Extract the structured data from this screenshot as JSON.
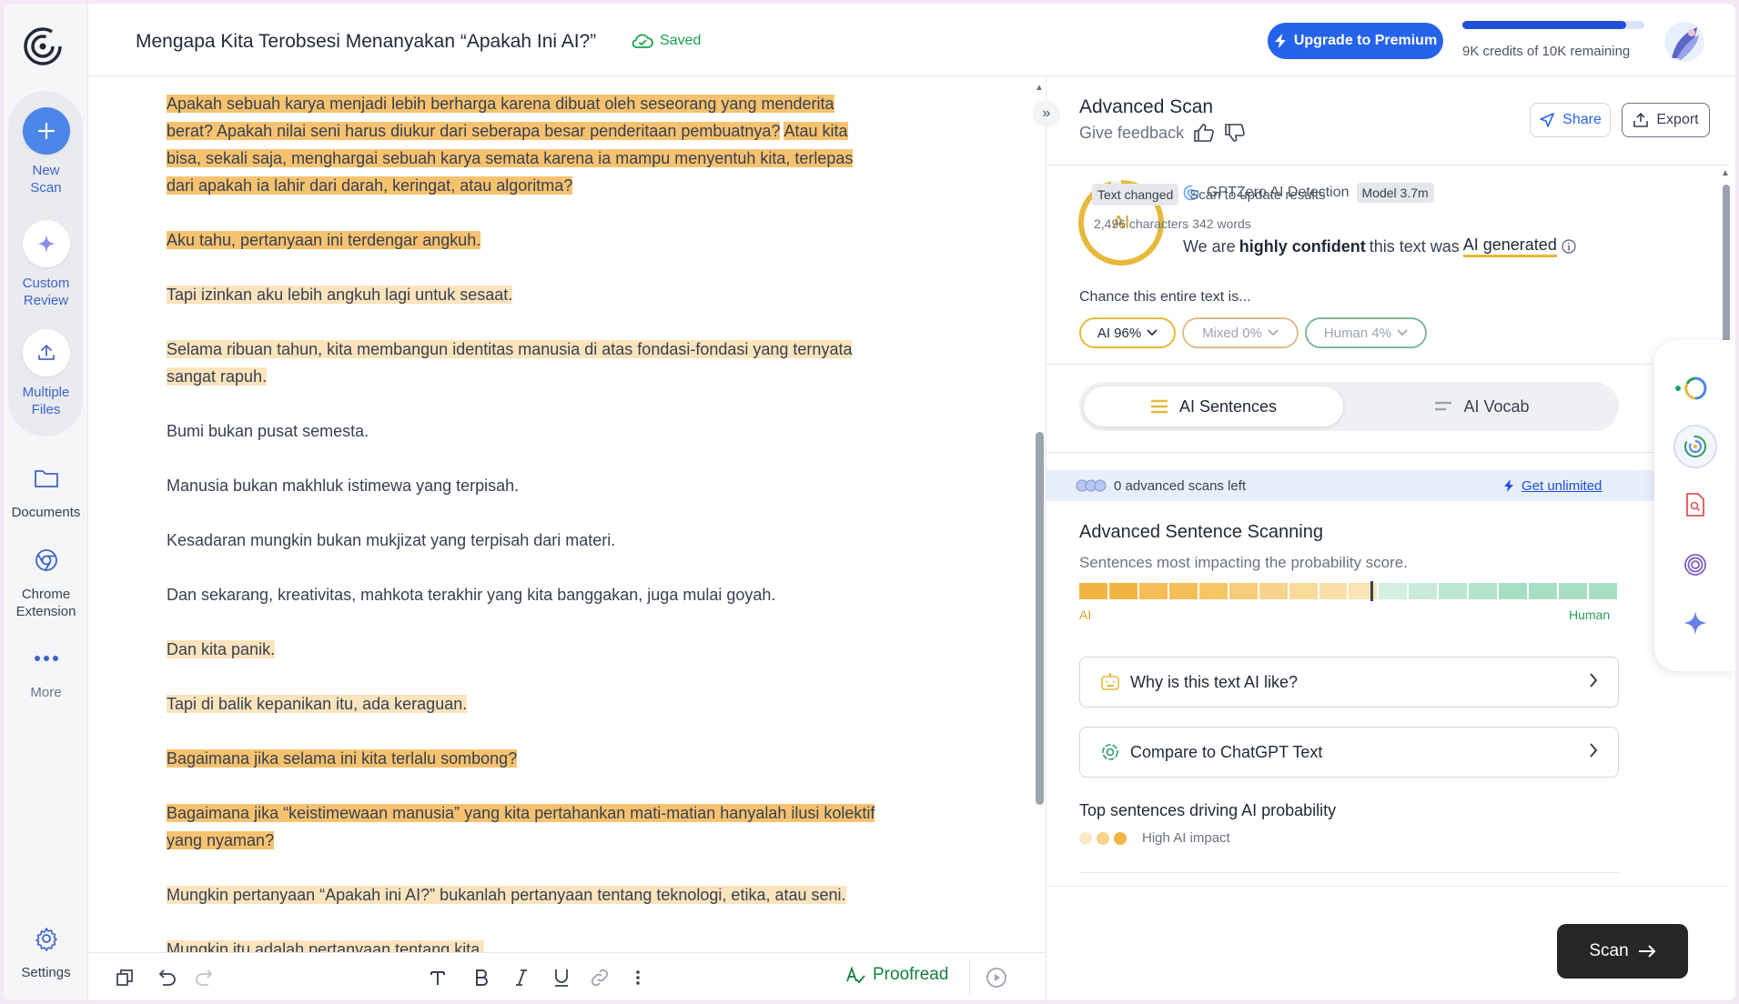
{
  "nav": {
    "new_scan": "New\nScan",
    "custom_review": "Custom\nReview",
    "multiple_files": "Multiple\nFiles",
    "documents": "Documents",
    "chrome_extension": "Chrome\nExtension",
    "more": "More",
    "settings": "Settings"
  },
  "header": {
    "doc_title": "Mengapa Kita Terobsesi Menanyakan “Apakah Ini AI?”",
    "saved": "Saved",
    "upgrade": "Upgrade to Premium",
    "credits_text": "9K credits of 10K remaining",
    "credits_fraction": 0.9
  },
  "editor": {
    "paragraphs": [
      [
        {
          "t": "Apakah sebuah karya menjadi lebih berharga karena dibuat oleh seseorang yang menderita berat? Apakah nilai seni harus diukur dari seberapa besar penderitaan pembuatnya?",
          "h": "high"
        },
        {
          "t": " ",
          "h": "none"
        },
        {
          "t": "Atau kita bisa, sekali saja, menghargai sebuah karya semata karena ia mampu menyentuh kita, terlepas dari apakah ia lahir dari darah, keringat, atau algoritma?",
          "h": "high"
        }
      ],
      [
        {
          "t": "Aku tahu, pertanyaan ini terdengar angkuh.",
          "h": "high"
        }
      ],
      [
        {
          "t": "Tapi izinkan aku lebih angkuh lagi untuk sesaat.",
          "h": "mid"
        }
      ],
      [
        {
          "t": "Selama ribuan tahun, kita membangun identitas manusia di atas fondasi-fondasi yang ternyata sangat rapuh.",
          "h": "mid"
        }
      ],
      [
        {
          "t": "Bumi bukan pusat semesta.",
          "h": "none"
        }
      ],
      [
        {
          "t": "Manusia bukan makhluk istimewa yang terpisah.",
          "h": "none"
        }
      ],
      [
        {
          "t": "Kesadaran mungkin bukan mukjizat yang terpisah dari materi.",
          "h": "none"
        }
      ],
      [
        {
          "t": "Dan sekarang, kreativitas, mahkota terakhir yang kita banggakan, juga mulai goyah.",
          "h": "none"
        }
      ],
      [
        {
          "t": "Dan kita panik.",
          "h": "mid"
        }
      ],
      [
        {
          "t": "Tapi di balik kepanikan itu, ada keraguan.",
          "h": "mid"
        }
      ],
      [
        {
          "t": "Bagaimana jika selama ini kita terlalu sombong?",
          "h": "high"
        }
      ],
      [
        {
          "t": "Bagaimana jika “keistimewaan manusia” yang kita pertahankan mati-matian hanyalah ilusi kolektif yang nyaman?",
          "h": "high"
        }
      ],
      [
        {
          "t": "Mungkin pertanyaan “Apakah ini AI?” bukanlah pertanyaan tentang teknologi, etika, atau seni.",
          "h": "mid"
        }
      ],
      [
        {
          "t": "Mungkin itu adalah pertanyaan tentang kita.",
          "h": "mid"
        }
      ]
    ]
  },
  "toolbar": {
    "proofread": "Proofread"
  },
  "panel": {
    "title": "Advanced Scan",
    "feedback": "Give feedback",
    "share": "Share",
    "export": "Export",
    "gauge_label": "AI",
    "gauge_fraction": 0.96,
    "detector": "GPTZero AI Detection",
    "model": "Model 3.7m",
    "confidence_pre": "We are",
    "confidence_bold": "highly confident",
    "confidence_mid": "this text was",
    "confidence_result": "AI generated",
    "chance_label": "Chance this entire text is...",
    "pill_ai": "AI 96%",
    "pill_mixed": "Mixed 0%",
    "pill_human": "Human 4%",
    "tab_sentences": "AI Sentences",
    "tab_vocab": "AI Vocab",
    "scans_left": "0 advanced scans left",
    "get_unlimited": "Get unlimited",
    "adv_title": "Advanced Sentence Scanning",
    "adv_sub": "Sentences most impacting the probability score.",
    "scale_ai": "AI",
    "scale_human": "Human",
    "scale_marker_fraction": 0.54,
    "scale_colors": [
      "#f2b544",
      "#f2b544",
      "#f4bd55",
      "#f4bd55",
      "#f5c566",
      "#f6cd7a",
      "#f7d38b",
      "#f8da9a",
      "#f9dfa8",
      "#f9e4b5",
      "#d2efe0",
      "#c8ebd9",
      "#bde7d2",
      "#b2e3cb",
      "#a8dfc4",
      "#a8dfc4",
      "#a8dfc4",
      "#a8dfc4"
    ],
    "why_ai": "Why is this text AI like?",
    "compare": "Compare to ChatGPT Text",
    "top_sentences": "Top sentences driving AI probability",
    "high_impact": "High AI impact",
    "text_changed": "Text changed",
    "scan_to_update": "Scan to update results",
    "chars_words": "2,496 characters 342 words",
    "scan": "Scan"
  },
  "colors": {
    "accent": "#2563eb",
    "ai_yellow": "#e7b93b",
    "highlight_high": "#f7c26f",
    "highlight_mid": "#fbe3bc",
    "human_green": "#2f9a62"
  }
}
